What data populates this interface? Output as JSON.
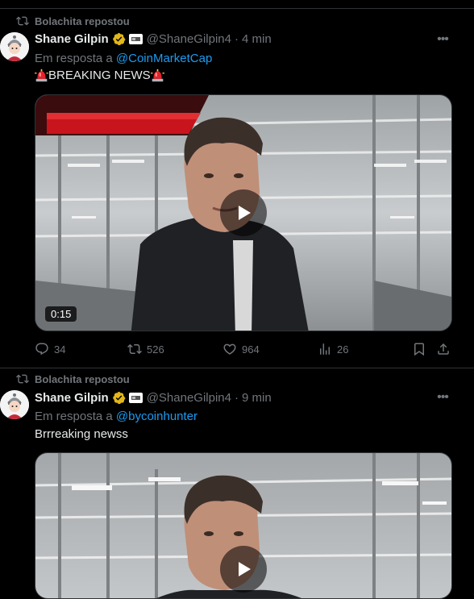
{
  "tweets": [
    {
      "repost_label": "Bolachita repostou",
      "name": "Shane Gilpin",
      "handle": "@ShaneGilpin4",
      "dot": "·",
      "time": "4 min",
      "reply_prefix": "Em resposta a",
      "reply_to": "@CoinMarketCap",
      "text": "BREAKING NEWS",
      "text_has_sirens": true,
      "video_duration": "0:15",
      "stats": {
        "replies": "34",
        "reposts": "526",
        "likes": "964",
        "views": "26"
      }
    },
    {
      "repost_label": "Bolachita repostou",
      "name": "Shane Gilpin",
      "handle": "@ShaneGilpin4",
      "dot": "·",
      "time": "9 min",
      "reply_prefix": "Em resposta a",
      "reply_to": "@bycoinhunter",
      "text": "Brrreaking newss"
    }
  ],
  "icons": {
    "repost": "repost-icon",
    "verified": "verified-badge-icon",
    "more": "more-icon",
    "play": "play-icon",
    "reply": "reply-icon",
    "like": "heart-icon",
    "views": "views-icon",
    "bookmark": "bookmark-icon",
    "share": "share-icon"
  },
  "colors": {
    "background": "#000000",
    "text": "#e7e9ea",
    "muted": "#71767b",
    "link": "#1d9bf0",
    "verified_gold": "#e2b719",
    "banner_red": "#c8141c"
  }
}
